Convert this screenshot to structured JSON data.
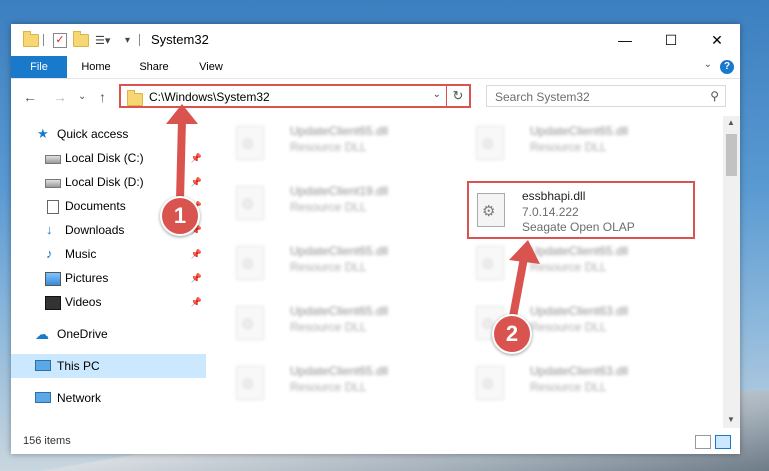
{
  "window": {
    "title": "System32",
    "controls": {
      "minimize": "—",
      "maximize": "☐",
      "close": "✕"
    }
  },
  "ribbon": {
    "tabs": [
      "File",
      "Home",
      "Share",
      "View"
    ],
    "help": "?"
  },
  "nav": {
    "back": "←",
    "forward": "→",
    "recent": "⌄",
    "up": "↑",
    "address": "C:\\Windows\\System32",
    "search_placeholder": "Search System32"
  },
  "sidebar": {
    "items": [
      {
        "label": "Quick access",
        "icon": "star-icon"
      },
      {
        "label": "Local Disk (C:)",
        "icon": "drive-icon",
        "pinned": true
      },
      {
        "label": "Local Disk (D:)",
        "icon": "drive-icon",
        "pinned": true
      },
      {
        "label": "Documents",
        "icon": "document-icon",
        "pinned": true
      },
      {
        "label": "Downloads",
        "icon": "download-icon",
        "pinned": true
      },
      {
        "label": "Music",
        "icon": "music-icon",
        "pinned": true
      },
      {
        "label": "Pictures",
        "icon": "picture-icon",
        "pinned": true
      },
      {
        "label": "Videos",
        "icon": "video-icon",
        "pinned": true
      },
      {
        "label": "OneDrive",
        "icon": "cloud-icon"
      },
      {
        "label": "This PC",
        "icon": "pc-icon",
        "selected": true
      },
      {
        "label": "Network",
        "icon": "network-icon"
      }
    ]
  },
  "files": [
    {
      "name": "UpdateClient65.dll",
      "desc": "Resource DLL"
    },
    {
      "name": "UpdateClient65.dll",
      "desc": "Resource DLL"
    },
    {
      "name": "UpdateClient19.dll",
      "desc": "Resource DLL"
    },
    {
      "name": "UpdateClient65.dll",
      "desc": "Resource DLL"
    },
    {
      "name": "UpdateClient65.dll",
      "desc": "Resource DLL"
    },
    {
      "name": "UpdateClient65.dll",
      "desc": "Resource DLL"
    },
    {
      "name": "UpdateClient63.dll",
      "desc": "Resource DLL"
    },
    {
      "name": "UpdateClient65.dll",
      "desc": "Resource DLL"
    },
    {
      "name": "UpdateClient63.dll",
      "desc": "Resource DLL"
    }
  ],
  "highlighted_file": {
    "name": "essbhapi.dll",
    "version": "7.0.14.222",
    "company": "Seagate Open OLAP"
  },
  "status": {
    "item_count": "156 items"
  },
  "callouts": {
    "one": "1",
    "two": "2"
  },
  "colors": {
    "accent": "#1979ca",
    "highlight": "#d9534f",
    "selected_bg": "#cce8ff"
  }
}
